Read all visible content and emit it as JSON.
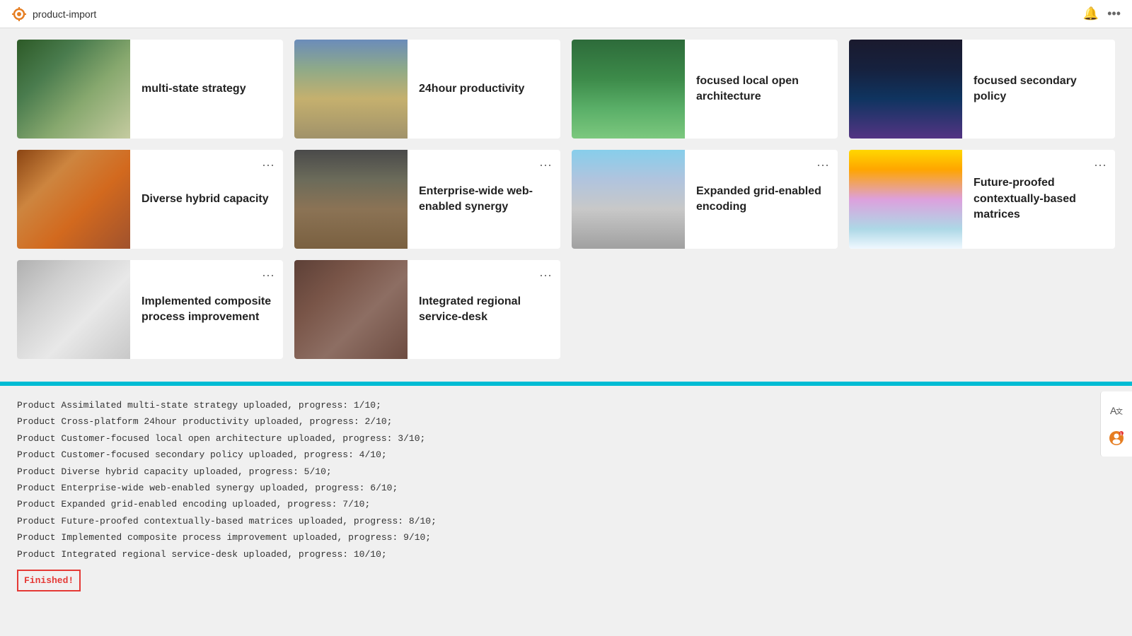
{
  "topbar": {
    "title": "product-import",
    "logo_icon": "sun-icon",
    "bell_icon": "bell-icon",
    "dots_icon": "more-icon"
  },
  "cards": [
    {
      "id": "card-1",
      "title": "multi-state strategy",
      "image_class": "img-forest",
      "alt": "forest landscape"
    },
    {
      "id": "card-2",
      "title": "24hour productivity",
      "image_class": "img-valley",
      "alt": "valley landscape"
    },
    {
      "id": "card-3",
      "title": "focused local open architecture",
      "image_class": "img-waterfall",
      "alt": "waterfall"
    },
    {
      "id": "card-4",
      "title": "focused secondary policy",
      "image_class": "img-mountain-night",
      "alt": "mountain at night"
    },
    {
      "id": "card-5",
      "title": "Diverse hybrid capacity",
      "image_class": "img-cafe",
      "alt": "cafe interior"
    },
    {
      "id": "card-6",
      "title": "Enterprise-wide web-enabled synergy",
      "image_class": "img-building",
      "alt": "building facade"
    },
    {
      "id": "card-7",
      "title": "Expanded grid-enabled encoding",
      "image_class": "img-city-aerial",
      "alt": "aerial city view"
    },
    {
      "id": "card-8",
      "title": "Future-proofed contextually-based matrices",
      "image_class": "img-clouds",
      "alt": "clouds sunset"
    },
    {
      "id": "card-9",
      "title": "Implemented composite process improvement",
      "image_class": "img-glass-roof",
      "alt": "glass roof architecture"
    },
    {
      "id": "card-10",
      "title": "Integrated regional service-desk",
      "image_class": "img-terrain",
      "alt": "terrain landscape"
    }
  ],
  "menu_dots_label": "···",
  "log": {
    "lines": [
      "Product Assimilated multi-state strategy uploaded, progress: 1/10;",
      "Product Cross-platform 24hour productivity uploaded, progress: 2/10;",
      "Product Customer-focused local open architecture uploaded, progress: 3/10;",
      "Product Customer-focused secondary policy uploaded, progress: 4/10;",
      "Product Diverse hybrid capacity uploaded, progress: 5/10;",
      "Product Enterprise-wide web-enabled synergy uploaded, progress: 6/10;",
      "Product Expanded grid-enabled encoding uploaded, progress: 7/10;",
      "Product Future-proofed contextually-based matrices uploaded, progress: 8/10;",
      "Product Implemented composite process improvement uploaded, progress: 9/10;",
      "Product Integrated regional service-desk uploaded, progress: 10/10;"
    ],
    "finished_label": "Finished!"
  },
  "side_panel": {
    "translate_icon": "translate-icon",
    "avatar_icon": "avatar-icon"
  }
}
